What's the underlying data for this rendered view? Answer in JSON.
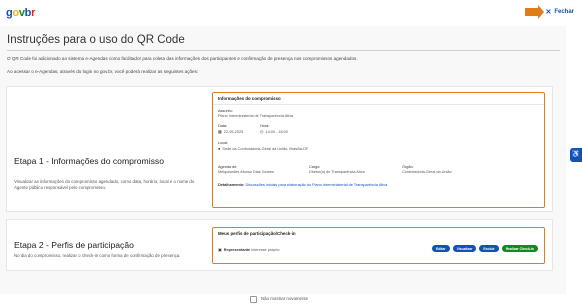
{
  "header": {
    "logo": {
      "g": "g",
      "o": "o",
      "v": "v",
      "b": "b",
      "r": "r"
    },
    "close_label": "Fechar",
    "close_x": "✕"
  },
  "page": {
    "title": "Instruções para o uso do QR Code",
    "intro1": "O QR Code foi adicionado ao sistema e-Agendas como facilitador para coleta das informações dos participantes e confirmação de presença nos compromissos agendados.",
    "intro2": "Ao acessar o e-Agendas, através do login no gov.br, você poderá realizar as seguintes ações:"
  },
  "step1": {
    "title": "Etapa 1 - Informações do compromisso",
    "desc": "Visualizar as informações do compromisso agendado, como data, horário, local e o nome do Agente público responsável pelo compromisso.",
    "box_title": "Informações do compromisso",
    "assunto_label": "Assunto:",
    "assunto_value": "Plano Interministerial de Transparência Ativa",
    "data_label": "Data:",
    "data_value": "22-05-2025",
    "hora_label": "Hora:",
    "hora_value": "14:00 - 18:00",
    "local_label": "Local:",
    "local_value": "Sede da Controladoria-Geral da União, Brasília-DF",
    "agenda_label": "Agenda de:",
    "agenda_value": "Melquisedes Afonso Dias Gomes",
    "cargo_label": "Cargo:",
    "cargo_value": "Diretor(a) de Transparência Ativa",
    "orgao_label": "Órgão:",
    "orgao_value": "Controladoria-Geral da União",
    "detalhamento_label": "Detalhamento:",
    "detalhamento_value": "Discussões iniciais para elaboração do Plano Interministerial de Transparência Ativa"
  },
  "step2": {
    "title": "Etapa 2 - Perfis de participação",
    "desc": "No dia do compromisso, realizar o check-in como forma de confirmação de presença.",
    "box_title": "Meus perfis de participação/Check-in",
    "role_label": "Representante",
    "role_sub": "interesse próprio",
    "buttons": {
      "editar": "Editar",
      "visualizar": "Visualizar",
      "excluir": "Excluir",
      "checkin": "Realizar Check-In"
    }
  },
  "footer": {
    "dont_show": "Não mostrar novamente"
  },
  "icons": {
    "calendar": "calendar-icon",
    "clock": "clock-icon",
    "pin": "map-pin-icon",
    "user": "user-card-icon",
    "accessibility": "accessibility-icon"
  },
  "colors": {
    "accent_orange": "#e07b1a",
    "govbr_blue": "#1351b4",
    "success_green": "#168821"
  }
}
